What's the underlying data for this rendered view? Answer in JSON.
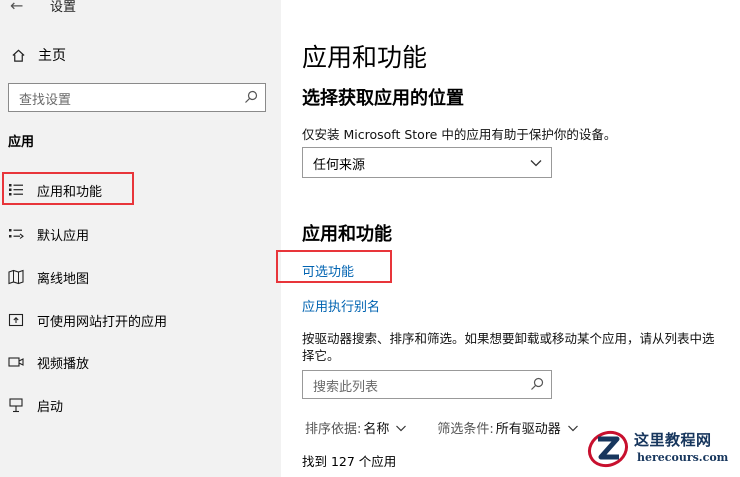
{
  "window": {
    "title": "设置"
  },
  "sidebar": {
    "home_label": "主页",
    "search_placeholder": "查找设置",
    "section_title": "应用",
    "items": [
      {
        "label": "应用和功能",
        "icon": "apps-list-icon",
        "active": true
      },
      {
        "label": "默认应用",
        "icon": "default-apps-icon"
      },
      {
        "label": "离线地图",
        "icon": "map-icon"
      },
      {
        "label": "可使用网站打开的应用",
        "icon": "open-in-browser-icon"
      },
      {
        "label": "视频播放",
        "icon": "video-icon"
      },
      {
        "label": "启动",
        "icon": "startup-icon"
      }
    ]
  },
  "main": {
    "title": "应用和功能",
    "section1": {
      "heading": "选择获取应用的位置",
      "description": "仅安装 Microsoft Store 中的应用有助于保护你的设备。",
      "dropdown_value": "任何来源"
    },
    "section2": {
      "heading": "应用和功能",
      "link_optional": "可选功能",
      "link_alias": "应用执行别名",
      "description": "按驱动器搜索、排序和筛选。如果想要卸载或移动某个应用，请从列表中选择它。",
      "search_placeholder": "搜索此列表",
      "sort_label": "排序依据:",
      "sort_value": "名称",
      "filter_label": "筛选条件:",
      "filter_value": "所有驱动器",
      "count_text": "找到 127 个应用"
    }
  },
  "watermark": {
    "line1": "这里教程网",
    "line2": "herecours.com"
  },
  "colors": {
    "accent_link": "#0063b1",
    "highlight": "#e8353a",
    "sidebar_bg": "#f2f2f2"
  }
}
